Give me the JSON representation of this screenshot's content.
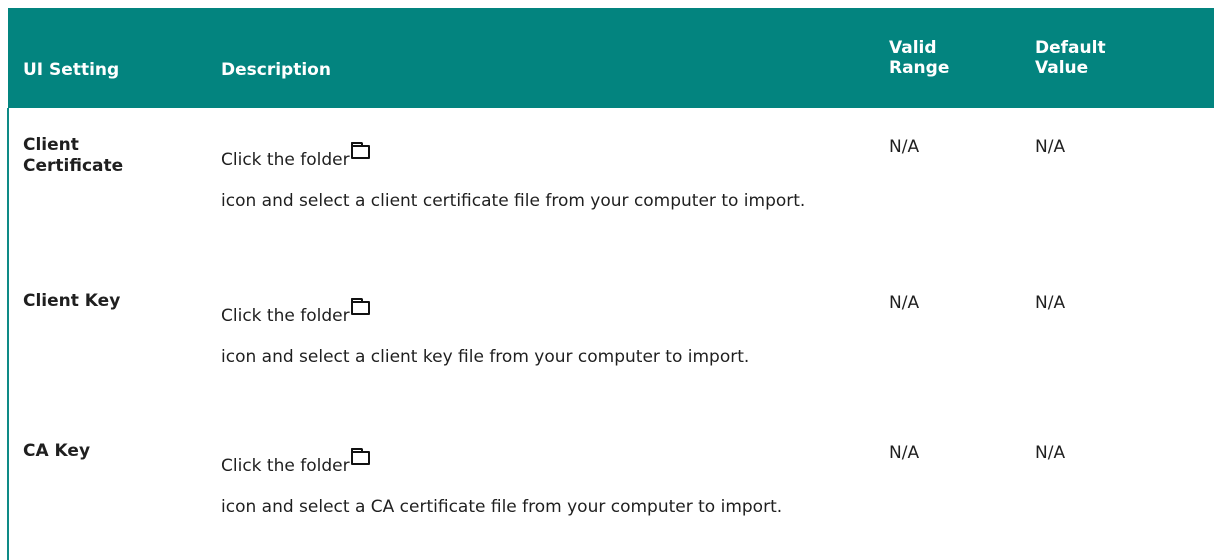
{
  "table": {
    "headers": {
      "setting": "UI Setting",
      "description": "Description",
      "valid_range": "Valid Range",
      "default_value": "Default Value"
    },
    "rows": [
      {
        "setting": "Client Certificate",
        "desc_prefix": "Click the folder",
        "desc_icon": "folder-icon",
        "desc_rest": "icon and select a client certificate file from your computer to import.",
        "valid_range": "N/A",
        "default_value": "N/A"
      },
      {
        "setting": "Client Key",
        "desc_prefix": "Click the folder",
        "desc_icon": "folder-icon",
        "desc_rest": "icon and select a client key file from your computer to import.",
        "valid_range": "N/A",
        "default_value": "N/A"
      },
      {
        "setting": "CA Key",
        "desc_prefix": "Click the folder",
        "desc_icon": "folder-icon",
        "desc_rest": "icon and select a CA certificate file from your computer to import.",
        "valid_range": "N/A",
        "default_value": "N/A"
      }
    ]
  },
  "colors": {
    "header_bg": "#03847f",
    "header_text": "#ffffff",
    "border": "#0e8a86"
  }
}
